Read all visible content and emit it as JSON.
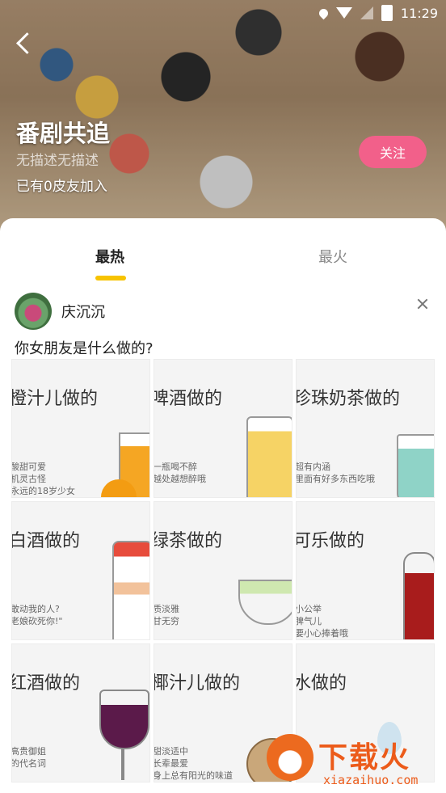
{
  "status_bar": {
    "time": "11:29"
  },
  "header": {
    "title": "番剧共追",
    "description": "无描述无描述",
    "members": "已有0皮友加入",
    "follow_label": "关注"
  },
  "tabs": [
    {
      "label": "最热",
      "active": true
    },
    {
      "label": "最火",
      "active": false
    }
  ],
  "post": {
    "username": "庆沉沉",
    "text": "你女朋友是什么做的?",
    "images": [
      {
        "title": "橙汁儿做的",
        "lines": [
          "酸甜可爱",
          "机灵古怪",
          "永远的18岁少女"
        ]
      },
      {
        "title": "啤酒做的",
        "lines": [
          "一瓶喝不醉",
          "越处越想醉哦"
        ]
      },
      {
        "title": "珍珠奶茶做的",
        "lines": [
          "超有内涵",
          "里面有好多东西吃哦"
        ]
      },
      {
        "title": "白酒做的",
        "lines": [
          "敢动我的人?",
          "老娘砍死你!\""
        ]
      },
      {
        "title": "绿茶做的",
        "lines": [
          "质淡雅",
          "甘无穷"
        ]
      },
      {
        "title": "可乐做的",
        "lines": [
          "小公举",
          "脾气儿",
          "要小心捧着哦"
        ]
      },
      {
        "title": "红酒做的",
        "lines": [
          "高贵御姐",
          "的代名词"
        ]
      },
      {
        "title": "椰汁儿做的",
        "lines": [
          "甜淡适中",
          "长辈最爱",
          "身上总有阳光的味道"
        ]
      },
      {
        "title": "水做的",
        "lines": []
      }
    ]
  },
  "watermark": {
    "brand": "下载火",
    "url": "xiazaihuo.com"
  },
  "colors": {
    "accent_yellow": "#f7c300",
    "follow_pink": "#f2608a",
    "watermark_orange": "#ec5b1a"
  }
}
